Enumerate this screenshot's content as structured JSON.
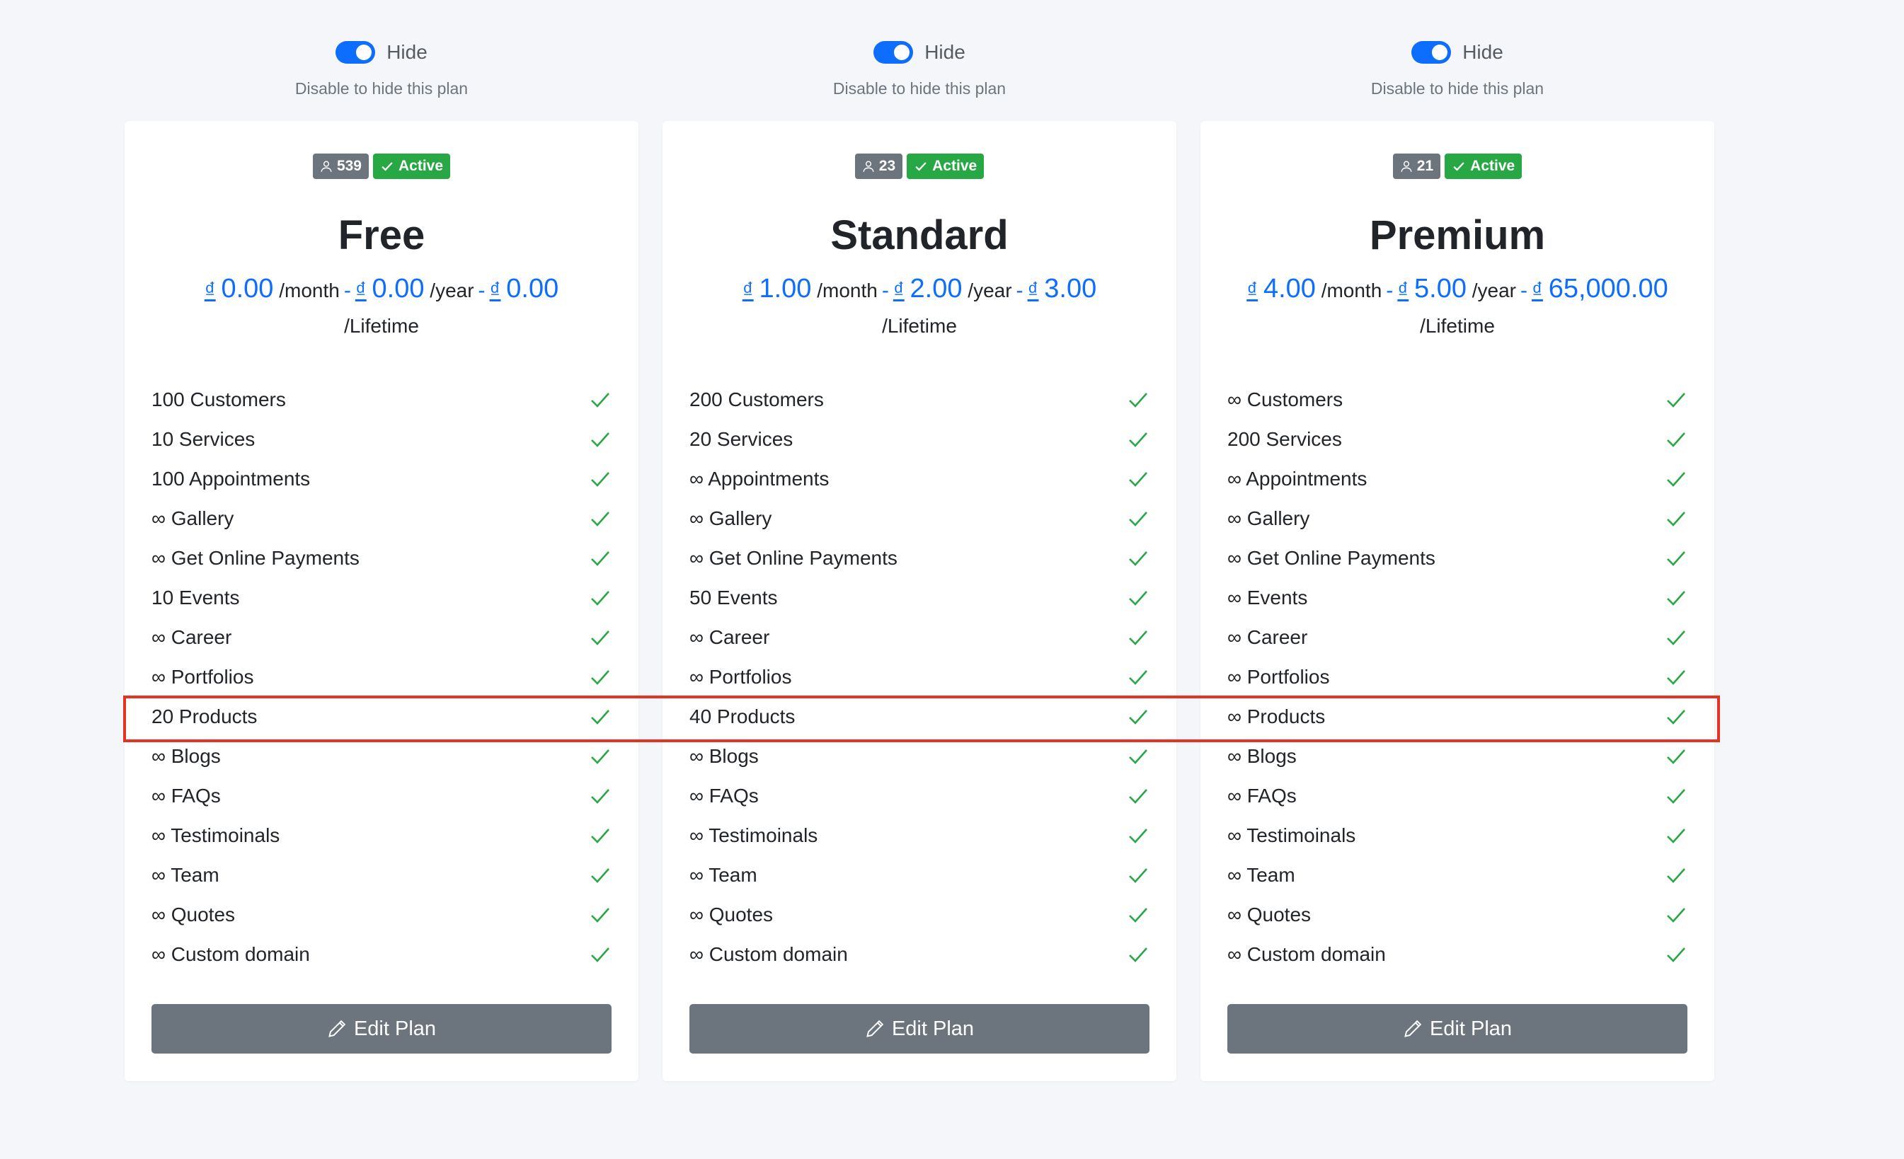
{
  "colors": {
    "primary": "#0d6efd",
    "success": "#28a745",
    "secondary": "#6c757d",
    "highlight": "#e53222"
  },
  "plans": [
    {
      "toggle": {
        "label": "Hide",
        "help": "Disable to hide this plan"
      },
      "users_count": "539",
      "status": "Active",
      "name": "Free",
      "currency": "₫",
      "price_month": "0.00",
      "price_year": "0.00",
      "price_lifetime": "0.00",
      "per_month": "/month",
      "per_year": "/year",
      "per_lifetime": "/Lifetime",
      "features": [
        "100 Customers",
        "10 Services",
        "100 Appointments",
        "∞ Gallery",
        "∞ Get Online Payments",
        "10 Events",
        "∞ Career",
        "∞ Portfolios",
        "20 Products",
        "∞ Blogs",
        "∞ FAQs",
        "∞ Testimoinals",
        "∞ Team",
        "∞ Quotes",
        "∞ Custom domain"
      ],
      "edit_label": "Edit Plan"
    },
    {
      "toggle": {
        "label": "Hide",
        "help": "Disable to hide this plan"
      },
      "users_count": "23",
      "status": "Active",
      "name": "Standard",
      "currency": "₫",
      "price_month": "1.00",
      "price_year": "2.00",
      "price_lifetime": "3.00",
      "per_month": "/month",
      "per_year": "/year",
      "per_lifetime": "/Lifetime",
      "features": [
        "200 Customers",
        "20 Services",
        "∞ Appointments",
        "∞ Gallery",
        "∞ Get Online Payments",
        "50 Events",
        "∞ Career",
        "∞ Portfolios",
        "40 Products",
        "∞ Blogs",
        "∞ FAQs",
        "∞ Testimoinals",
        "∞ Team",
        "∞ Quotes",
        "∞ Custom domain"
      ],
      "edit_label": "Edit Plan"
    },
    {
      "toggle": {
        "label": "Hide",
        "help": "Disable to hide this plan"
      },
      "users_count": "21",
      "status": "Active",
      "name": "Premium",
      "currency": "₫",
      "price_month": "4.00",
      "price_year": "5.00",
      "price_lifetime": "65,000.00",
      "per_month": "/month",
      "per_year": "/year",
      "per_lifetime": "/Lifetime",
      "features": [
        "∞ Customers",
        "200 Services",
        "∞ Appointments",
        "∞ Gallery",
        "∞ Get Online Payments",
        "∞ Events",
        "∞ Career",
        "∞ Portfolios",
        "∞ Products",
        "∞ Blogs",
        "∞ FAQs",
        "∞ Testimoinals",
        "∞ Team",
        "∞ Quotes",
        "∞ Custom domain"
      ],
      "edit_label": "Edit Plan"
    }
  ]
}
